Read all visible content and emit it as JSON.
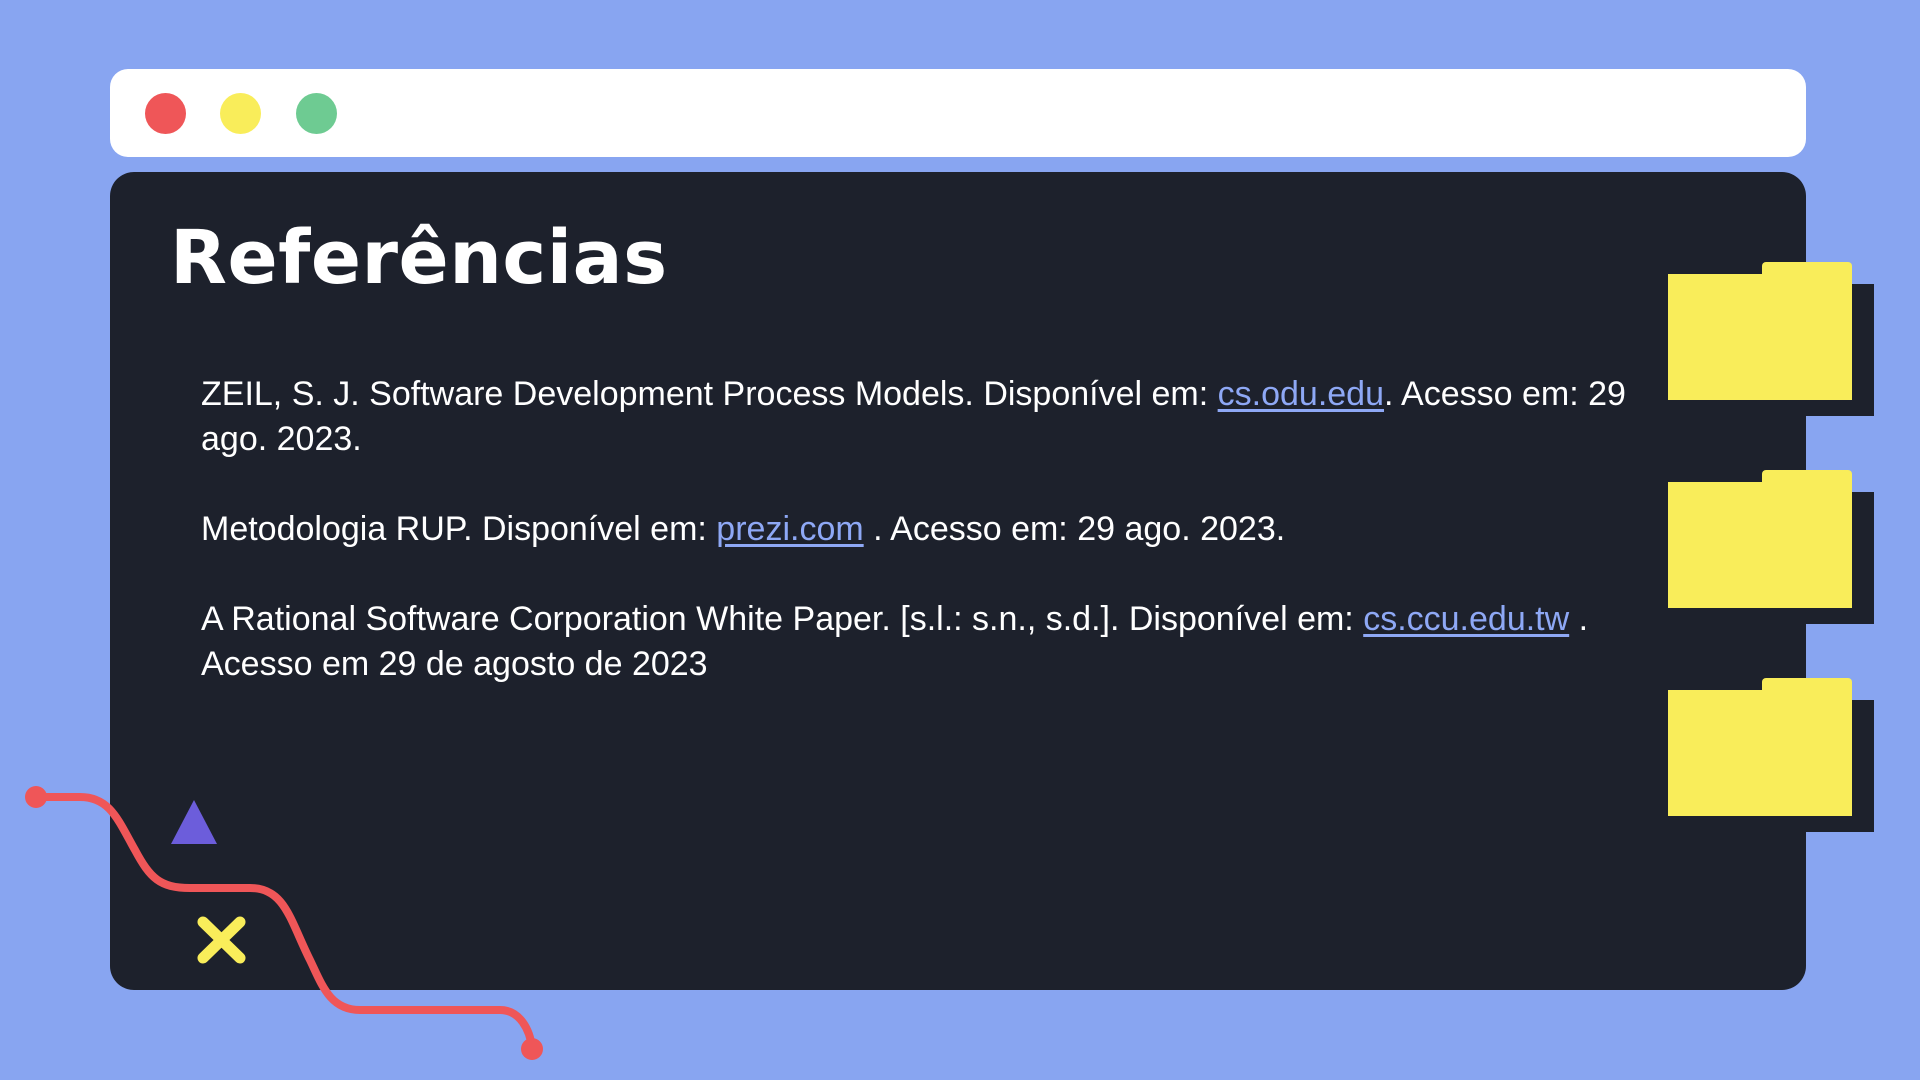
{
  "window": {
    "controls": [
      {
        "name": "close",
        "color": "#ef5658"
      },
      {
        "name": "minimize",
        "color": "#f9ed5a"
      },
      {
        "name": "maximize",
        "color": "#6ecb92"
      }
    ]
  },
  "slide": {
    "title": "Referências",
    "references": [
      {
        "before": "ZEIL, S. J. Software Development Process Models. Disponível em: ",
        "link": "cs.odu.edu",
        "after": ". Acesso em: 29 ago. 2023."
      },
      {
        "before": "Metodologia RUP. Disponível em: ",
        "link": "prezi.com",
        "after": " . Acesso em: 29 ago. 2023."
      },
      {
        "before": "A Rational Software Corporation White Paper. [s.l.: s.n., s.d.]. Disponível em: ",
        "link": "cs.ccu.edu.tw",
        "after": " . Acesso em 29 de agosto de 2023"
      }
    ]
  },
  "decorations": {
    "folders": [
      "folder-icon",
      "folder-icon",
      "folder-icon"
    ],
    "shapes": [
      "triangle-icon",
      "x-mark-icon",
      "curved-line"
    ]
  },
  "colors": {
    "background": "#88a5f1",
    "panel": "#1d212c",
    "link": "#8ea8f5",
    "accent_yellow": "#f9ed5a",
    "accent_red": "#ef5658",
    "accent_purple": "#6c5ddb"
  }
}
